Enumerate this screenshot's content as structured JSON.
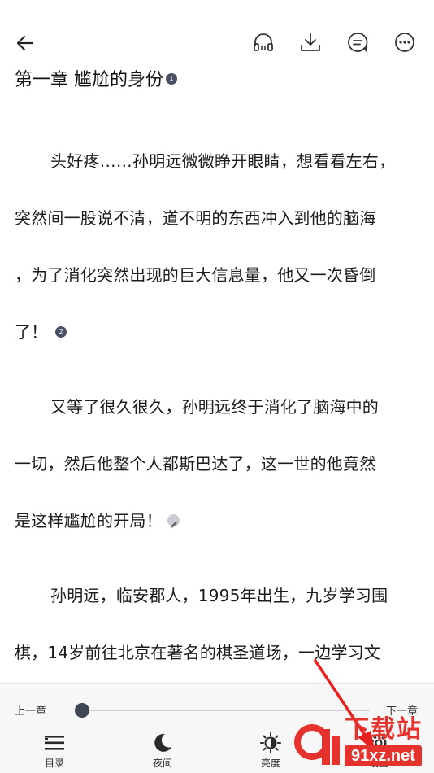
{
  "topbar": {
    "icons": [
      "back-arrow-icon",
      "headphones-icon",
      "download-icon",
      "comment-icon",
      "more-icon"
    ]
  },
  "chapter": {
    "title": "第一章 尴尬的身份",
    "title_note": "1",
    "lines": [
      {
        "text": "头好疼……孙明远微微睁开眼睛，想看看左右，",
        "indent": true
      },
      {
        "text": "突然间一股说不清，道不明的东西冲入到他的脑海",
        "indent": false
      },
      {
        "text": "，为了消化突然出现的巨大信息量，他又一次昏倒",
        "indent": false
      },
      {
        "text": "了！",
        "indent": false,
        "note": "2"
      },
      {
        "text": "又等了很久很久，孙明远终于消化了脑海中的",
        "indent": true
      },
      {
        "text": "一切，然后他整个人都斯巴达了，这一世的他竟然",
        "indent": false
      },
      {
        "text": "是这样尴尬的开局！",
        "indent": false,
        "pencil": true
      },
      {
        "text": "孙明远，临安郡人，1995年出生，九岁学习围",
        "indent": true
      },
      {
        "text": "棋，14岁前往北京在著名的棋圣道场，一边学习文",
        "indent": false
      }
    ]
  },
  "progress": {
    "prev_label": "上一章",
    "next_label": "下一章",
    "value": 0.0
  },
  "tabs": [
    {
      "label": "目录",
      "icon": "list-icon"
    },
    {
      "label": "夜间",
      "icon": "moon-icon"
    },
    {
      "label": "亮度",
      "icon": "brightness-icon"
    },
    {
      "label": "设置",
      "icon": "gear-icon"
    }
  ],
  "watermark": {
    "text": "下载站",
    "url": "91xz.net"
  },
  "colors": {
    "accent_dark": "#3f4656",
    "arrow_red": "#e8211e",
    "watermark_red": "#e5322d"
  }
}
